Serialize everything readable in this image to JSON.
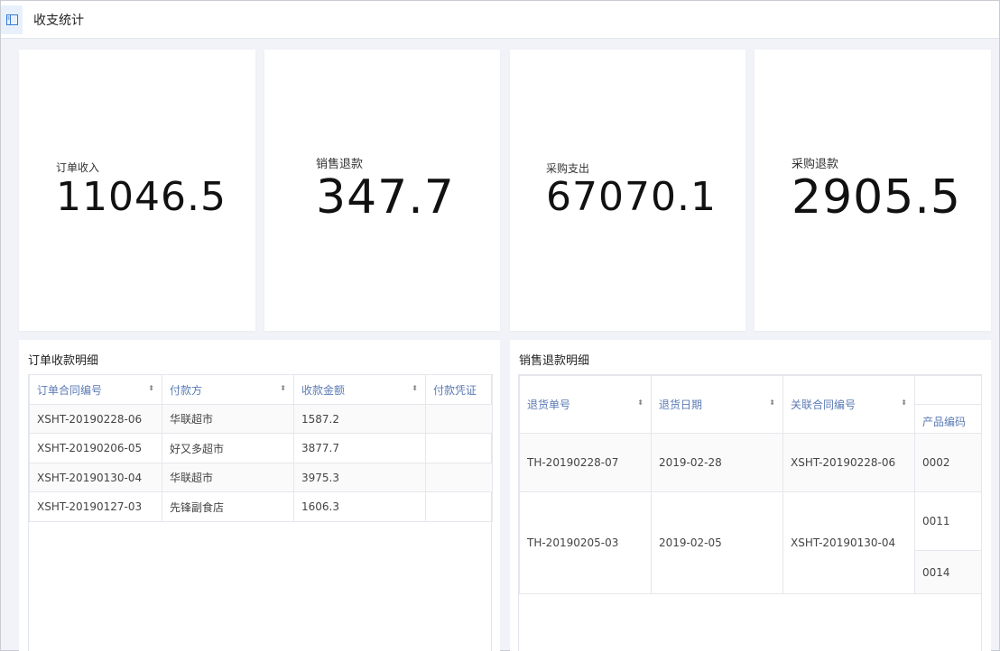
{
  "header": {
    "title": "收支统计"
  },
  "stats": [
    {
      "label": "订单收入",
      "value": "11046.5"
    },
    {
      "label": "销售退款",
      "value": "347.7"
    },
    {
      "label": "采购支出",
      "value": "67070.1"
    },
    {
      "label": "采购退款",
      "value": "2905.5"
    }
  ],
  "orders": {
    "title": "订单收款明细",
    "columns": [
      "订单合同编号",
      "付款方",
      "收款金额",
      "付款凭证"
    ],
    "rows": [
      [
        "XSHT-20190228-06",
        "华联超市",
        "1587.2",
        ""
      ],
      [
        "XSHT-20190206-05",
        "好又多超市",
        "3877.7",
        ""
      ],
      [
        "XSHT-20190130-04",
        "华联超市",
        "3975.3",
        ""
      ],
      [
        "XSHT-20190127-03",
        "先锋副食店",
        "1606.3",
        ""
      ]
    ]
  },
  "refunds": {
    "title": "销售退款明细",
    "columns": [
      "退货单号",
      "退货日期",
      "关联合同编号",
      "产品编码"
    ],
    "rows": [
      {
        "no": "TH-20190228-07",
        "date": "2019-02-28",
        "contract": "XSHT-20190228-06",
        "codes": [
          "0002"
        ]
      },
      {
        "no": "TH-20190205-03",
        "date": "2019-02-05",
        "contract": "XSHT-20190130-04",
        "codes": [
          "0011",
          "0014"
        ]
      }
    ]
  }
}
